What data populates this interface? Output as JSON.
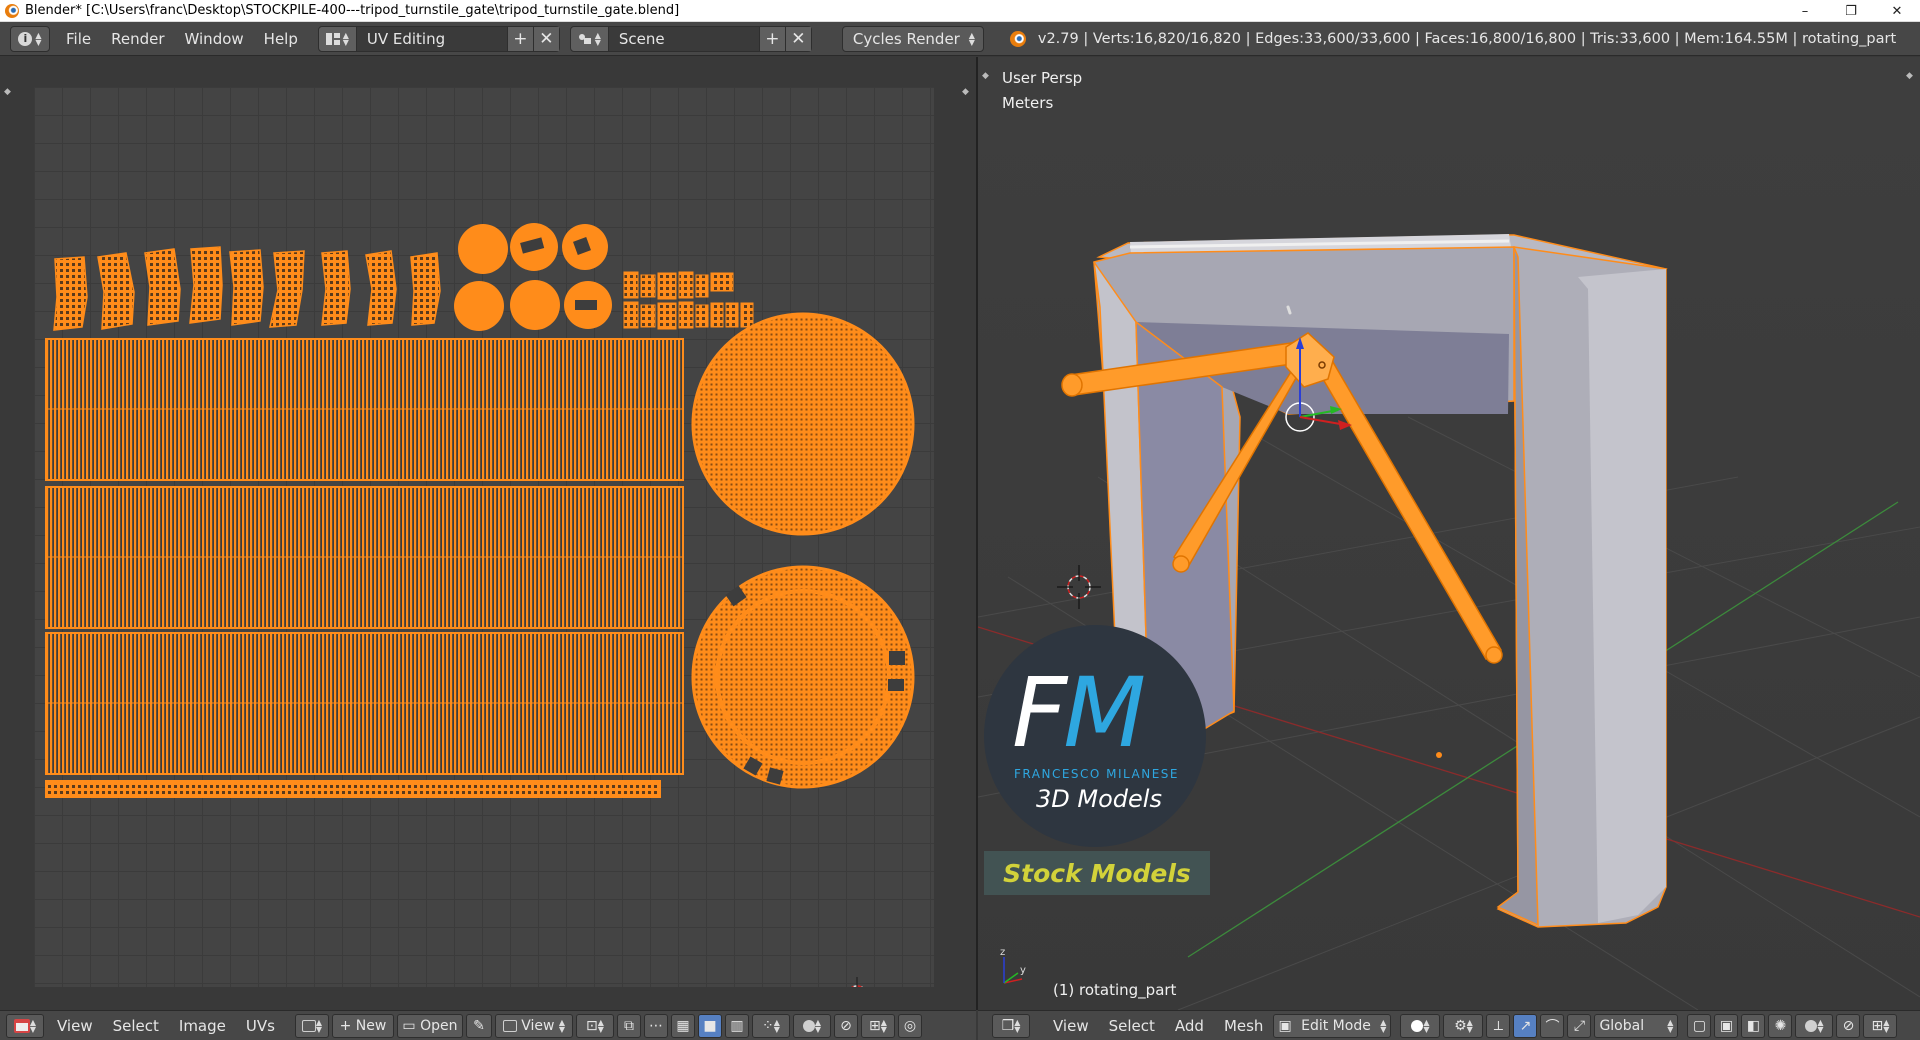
{
  "window": {
    "title": "Blender* [C:\\Users\\franc\\Desktop\\STOCKPILE-400---tripod_turnstile_gate\\tripod_turnstile_gate.blend]",
    "minimize": "–",
    "restore": "❐",
    "close": "✕"
  },
  "info_header": {
    "menus": [
      "File",
      "Render",
      "Window",
      "Help"
    ],
    "layout": "UV Editing",
    "scene": "Scene",
    "render_engine": "Cycles Render",
    "stats": "v2.79 | Verts:16,820/16,820 | Edges:33,600/33,600 | Faces:16,800/16,800 | Tris:33,600 | Mem:164.55M | rotating_part"
  },
  "uv_editor": {
    "menus": [
      "View",
      "Select",
      "Image",
      "UVs"
    ],
    "new_label": "New",
    "open_label": "Open",
    "view_label": "View",
    "uv_color": "#ff8c1a"
  },
  "viewport": {
    "view_name": "User Persp",
    "units": "Meters",
    "object_label": "(1) rotating_part",
    "menus": [
      "View",
      "Select",
      "Add",
      "Mesh"
    ],
    "mode": "Edit Mode",
    "orientation": "Global",
    "watermark": {
      "letters_f": "F",
      "letters_m": "M",
      "name": "FRANCESCO MILANESE",
      "subtitle": "3D Models",
      "stock": "Stock Models"
    }
  },
  "icons": {
    "editor_info": "info-icon",
    "editor_uv": "image-editor-icon",
    "editor_3d": "cube-icon",
    "cursor": "3d-cursor-icon",
    "axis_gizmo": "axis-gizmo-icon"
  }
}
